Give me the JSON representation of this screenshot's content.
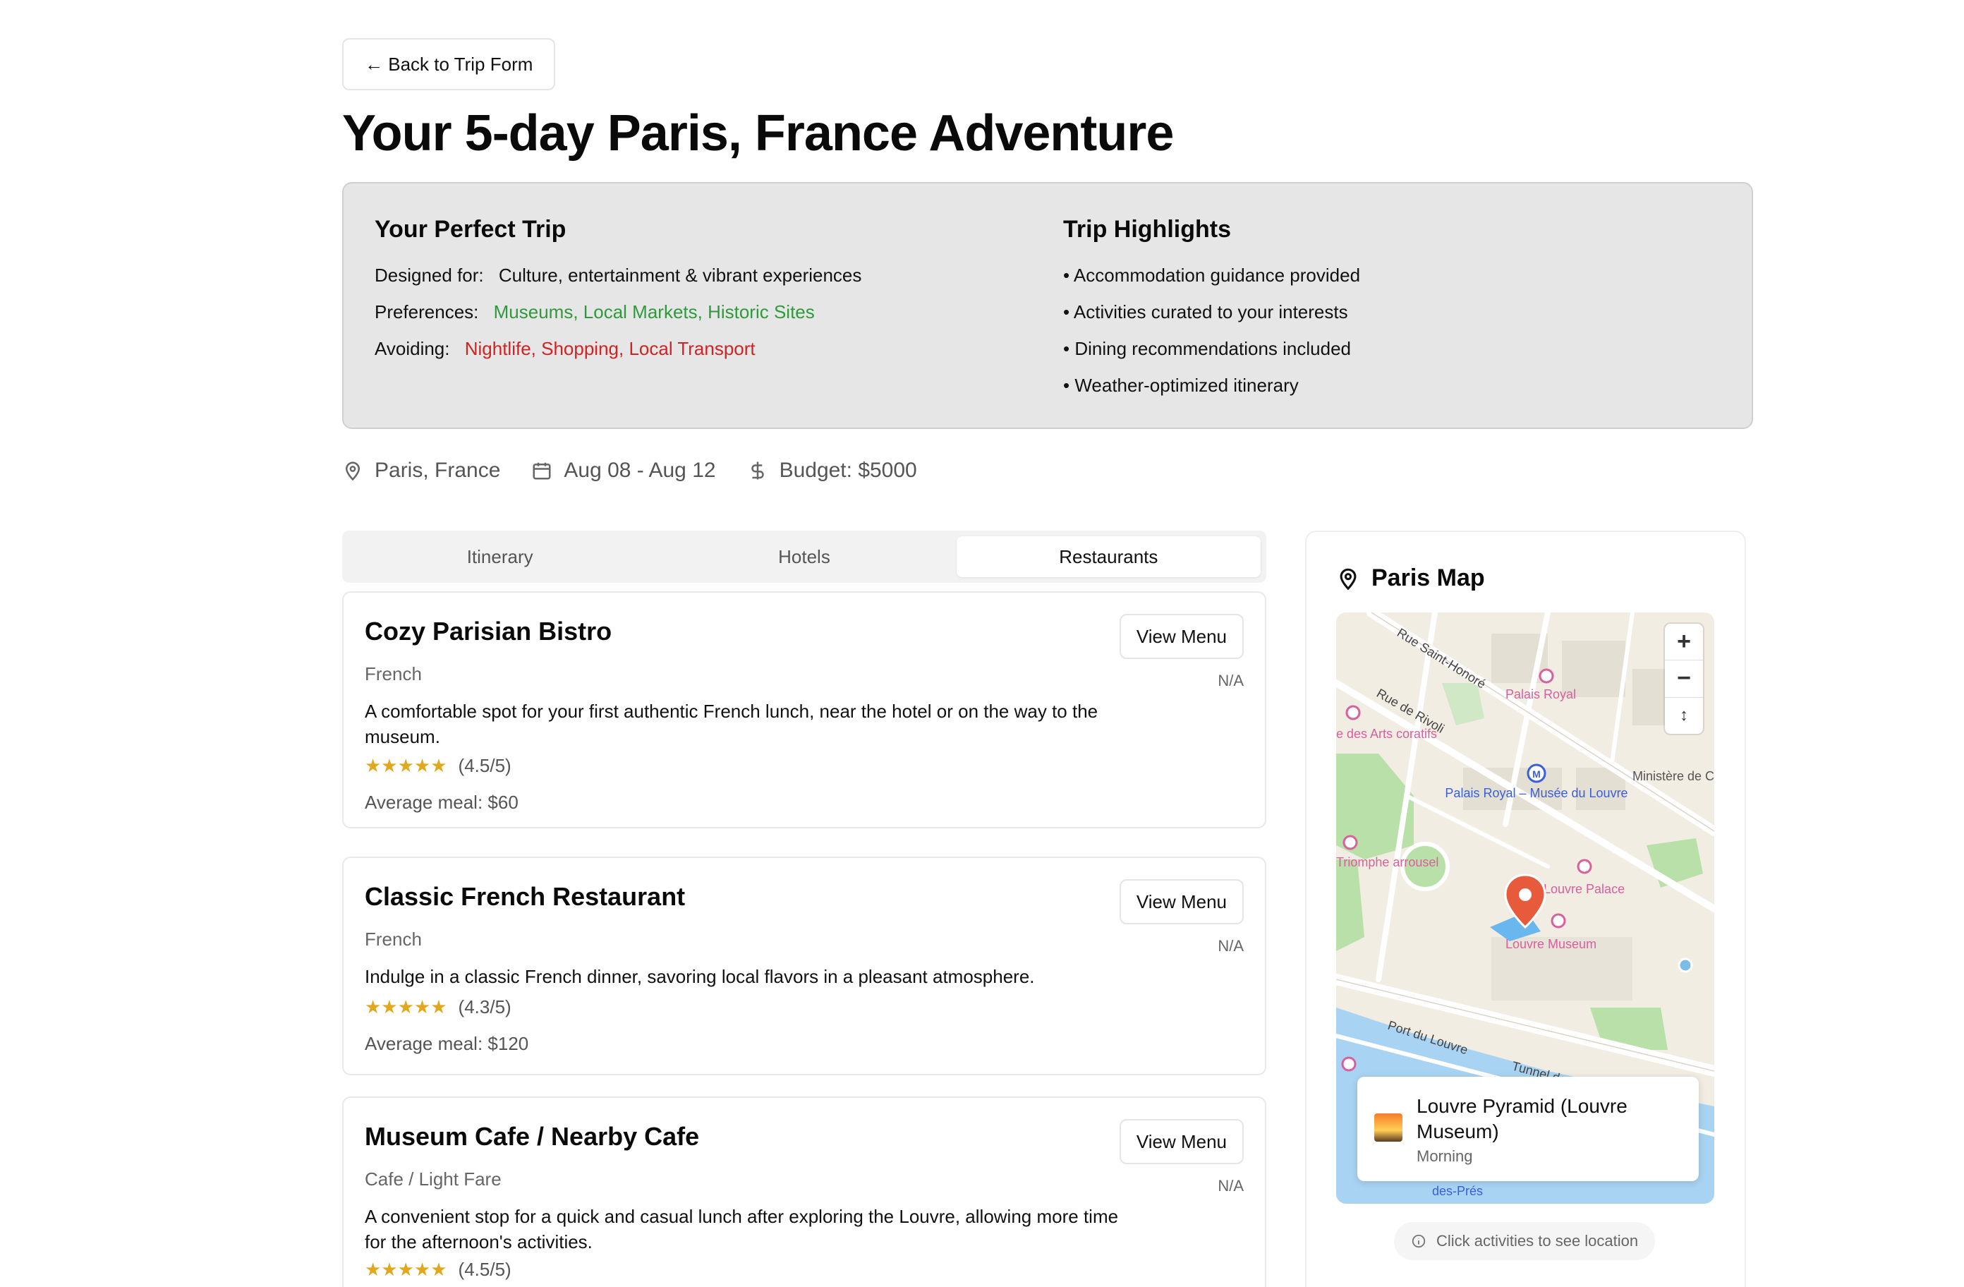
{
  "back_button": {
    "label": "← Back to Trip Form"
  },
  "page_title": "Your 5-day Paris, France Adventure",
  "summary": {
    "perfect_trip": {
      "heading": "Your Perfect Trip",
      "designed_for_label": "Designed for:",
      "designed_for_value": "Culture, entertainment & vibrant experiences",
      "preferences_label": "Preferences:",
      "preferences_value": "Museums, Local Markets, Historic Sites",
      "avoiding_label": "Avoiding:",
      "avoiding_value": "Nightlife, Shopping, Local Transport"
    },
    "highlights": {
      "heading": "Trip Highlights",
      "items": [
        "• Accommodation guidance provided",
        "• Activities curated to your interests",
        "• Dining recommendations included",
        "• Weather-optimized itinerary"
      ]
    }
  },
  "meta": {
    "location": "Paris, France",
    "dates": "Aug 08 - Aug 12",
    "budget": "Budget: $5000"
  },
  "tabs": [
    {
      "label": "Itinerary",
      "active": false
    },
    {
      "label": "Hotels",
      "active": false
    },
    {
      "label": "Restaurants",
      "active": true
    }
  ],
  "restaurants": [
    {
      "name": "Cozy Parisian Bistro",
      "cuisine": "French",
      "description": "A comfortable spot for your first authentic French lunch, near the hotel or on the way to the museum.",
      "stars": "★★★★★",
      "rating": "(4.5/5)",
      "average_meal": "Average meal: $60",
      "menu_label": "View Menu",
      "price_tag": "N/A"
    },
    {
      "name": "Classic French Restaurant",
      "cuisine": "French",
      "description": "Indulge in a classic French dinner, savoring local flavors in a pleasant atmosphere.",
      "stars": "★★★★★",
      "rating": "(4.3/5)",
      "average_meal": "Average meal: $120",
      "menu_label": "View Menu",
      "price_tag": "N/A"
    },
    {
      "name": "Museum Cafe / Nearby Cafe",
      "cuisine": "Cafe / Light Fare",
      "description": "A convenient stop for a quick and casual lunch after exploring the Louvre, allowing more time for the afternoon's activities.",
      "stars": "★★★★★",
      "rating": "(4.5/5)",
      "menu_label": "View Menu",
      "price_tag": "N/A"
    }
  ],
  "map": {
    "title": "Paris Map",
    "labels": {
      "rue_saint_honore": "Rue Saint-Honoré",
      "rue_de_rivoli": "Rue de Rivoli",
      "palais_royal": "Palais Royal",
      "metro": "Palais Royal – Musée du Louvre",
      "ministere": "Ministère de Culture et de Communicati",
      "arts_deco": "e des Arts coratifs",
      "triomphe": "Triomphe arrousel",
      "louvre_palace": "Louvre Palace",
      "louvre_museum": "Louvre Museum",
      "port_du_louvre": "Port du Louvre",
      "tunnel": "Tunnel des Tuileries",
      "des_pres": "des-Prés"
    },
    "popup": {
      "title": "Louvre Pyramid (Louvre Museum)",
      "time": "Morning"
    },
    "hint": "Click activities to see location",
    "colors": {
      "pin": "#e85a3c",
      "water": "#a9d3f2",
      "park": "#b8e0a8",
      "poi": "#d8609c",
      "metro": "#3a5fd9"
    }
  }
}
